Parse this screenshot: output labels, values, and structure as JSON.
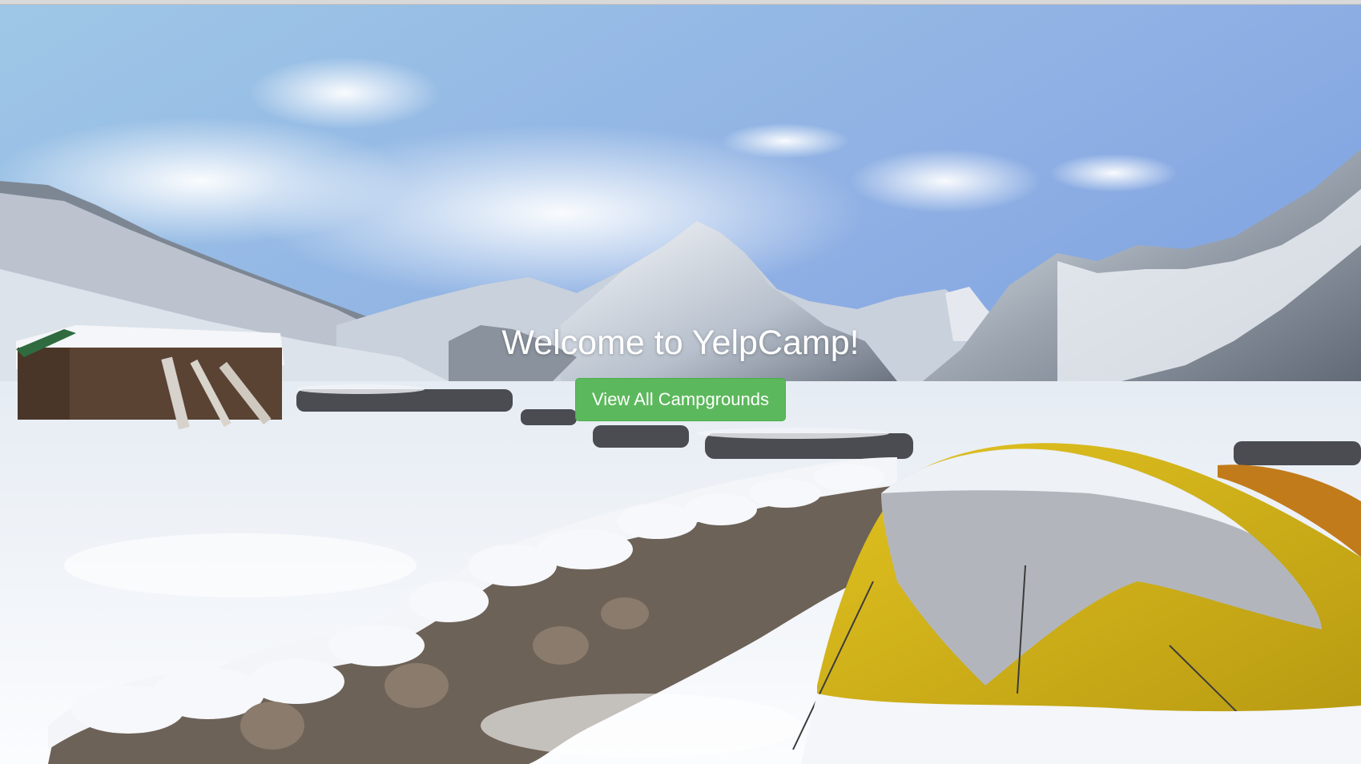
{
  "landing": {
    "title": "Welcome to YelpCamp!",
    "button_label": "View All Campgrounds"
  },
  "colors": {
    "button_bg": "#5cb85c",
    "title_text": "#ffffff"
  },
  "background": {
    "description_icon": "snowy-mountain-campsite-photo"
  }
}
